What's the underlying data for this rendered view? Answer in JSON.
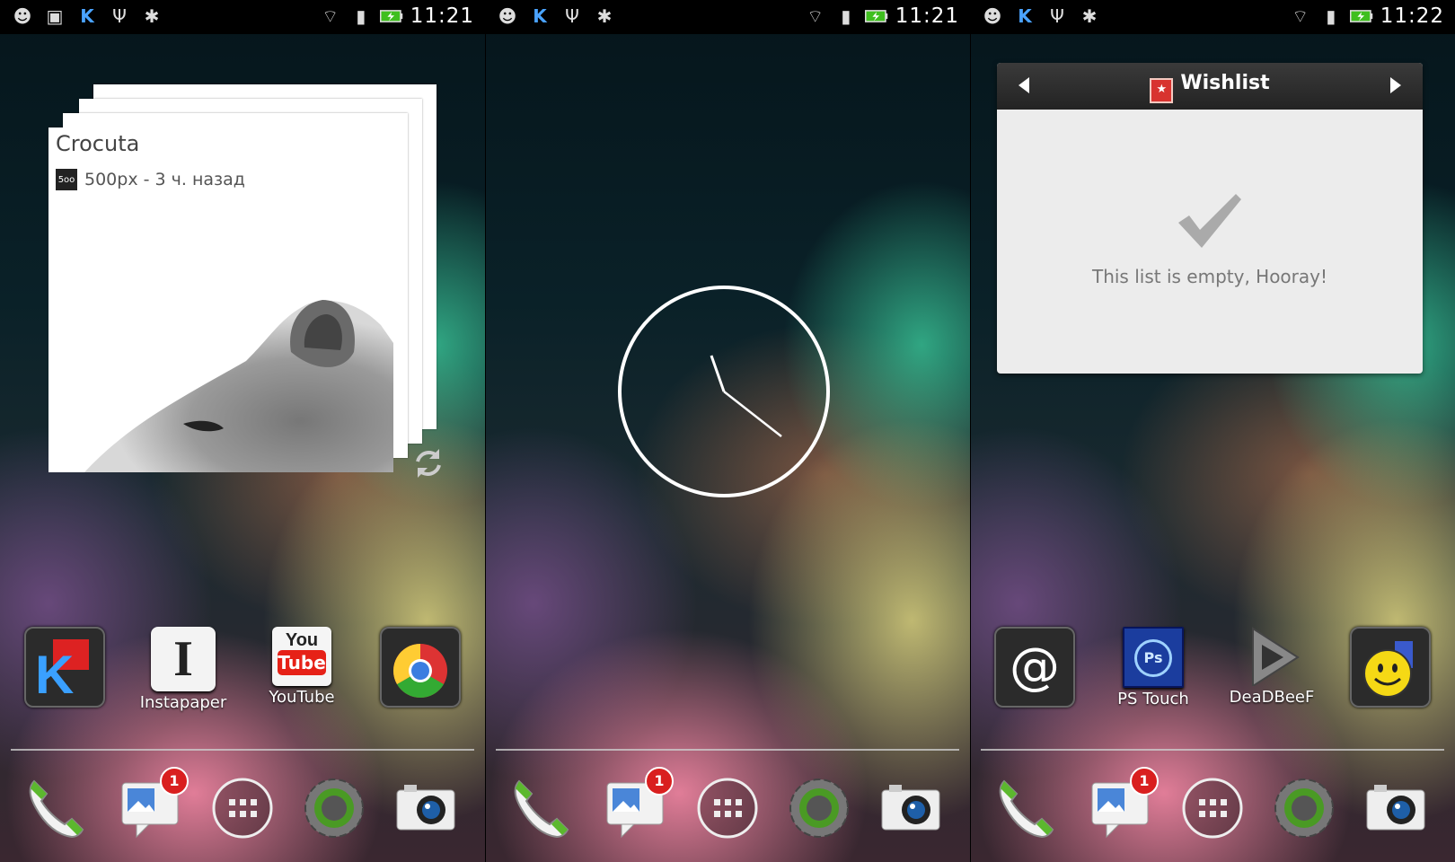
{
  "status_bars": [
    {
      "time": "11:21"
    },
    {
      "time": "11:21"
    },
    {
      "time": "11:22"
    }
  ],
  "screen1": {
    "photo_widget": {
      "title": "Crocuta",
      "source_logo": "5oo",
      "source_text": "500px - 3 ч. назад"
    },
    "apps": [
      {
        "name": "kate-mobile",
        "label": ""
      },
      {
        "name": "instapaper",
        "label": "Instapaper",
        "icon_text": "I"
      },
      {
        "name": "youtube",
        "label": "YouTube",
        "icon_text_top": "You",
        "icon_text_bottom": "Tube"
      },
      {
        "name": "chrome",
        "label": ""
      }
    ]
  },
  "screen3": {
    "wishlist": {
      "title": "Wishlist",
      "empty_message": "This list is empty, Hooray!"
    },
    "apps": [
      {
        "name": "email",
        "label": "",
        "icon_text": "@"
      },
      {
        "name": "ps-touch",
        "label": "PS Touch",
        "icon_text": "Ps"
      },
      {
        "name": "deadbeef",
        "label": "DeaDBeeF"
      },
      {
        "name": "smiley",
        "label": ""
      }
    ]
  },
  "dock": {
    "messages_badge": "1",
    "launcher_dots": "⋮⋮⋮"
  },
  "colors": {
    "badge": "#d91f1f",
    "youtube_red": "#e62117",
    "ps_blue": "#1b3d9e",
    "wishlist_red": "#d8332f"
  }
}
